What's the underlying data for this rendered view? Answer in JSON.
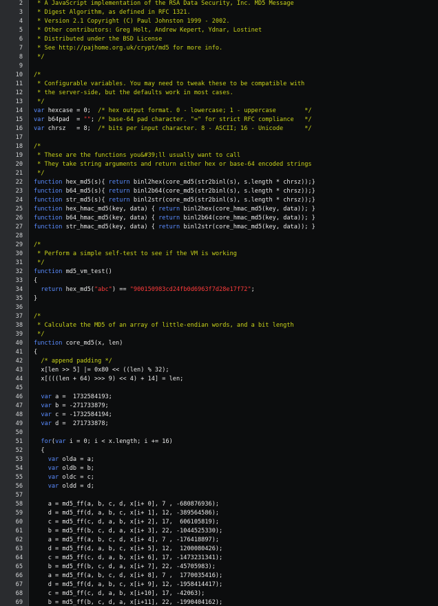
{
  "editor": {
    "language": "JavaScript",
    "colors": {
      "background": "#0c0d0e",
      "gutter": "#2a2c2f",
      "comment": "#c9d31a",
      "keyword": "#5a8cff",
      "string": "#ff3b3b",
      "text": "#eaeaea"
    },
    "lines": [
      {
        "n": "2",
        "t": " * A JavaScript implementation of the RSA Data Security, Inc. MD5 Message"
      },
      {
        "n": "3",
        "t": " * Digest Algorithm, as defined in RFC 1321."
      },
      {
        "n": "4",
        "t": " * Version 2.1 Copyright (C) Paul Johnston 1999 - 2002."
      },
      {
        "n": "5",
        "t": " * Other contributors: Greg Holt, Andrew Kepert, Ydnar, Lostinet"
      },
      {
        "n": "6",
        "t": " * Distributed under the BSD License"
      },
      {
        "n": "7",
        "t": " * See http://pajhome.org.uk/crypt/md5 for more info."
      },
      {
        "n": "8",
        "t": " */"
      },
      {
        "n": "9",
        "t": ""
      },
      {
        "n": "10",
        "t": "/*"
      },
      {
        "n": "11",
        "t": " * Configurable variables. You may need to tweak these to be compatible with"
      },
      {
        "n": "12",
        "t": " * the server-side, but the defaults work in most cases."
      },
      {
        "n": "13",
        "t": " */"
      },
      {
        "n": "14",
        "t": "var hexcase = 0;  /* hex output format. 0 - lowercase; 1 - uppercase        */"
      },
      {
        "n": "15",
        "t": "var b64pad  = \"\"; /* base-64 pad character. \"=\" for strict RFC compliance   */"
      },
      {
        "n": "16",
        "t": "var chrsz   = 8;  /* bits per input character. 8 - ASCII; 16 - Unicode      */"
      },
      {
        "n": "17",
        "t": ""
      },
      {
        "n": "18",
        "t": "/*"
      },
      {
        "n": "19",
        "t": " * These are the functions you&#39;ll usually want to call"
      },
      {
        "n": "20",
        "t": " * They take string arguments and return either hex or base-64 encoded strings"
      },
      {
        "n": "21",
        "t": " */"
      },
      {
        "n": "22",
        "t": "function hex_md5(s){ return binl2hex(core_md5(str2binl(s), s.length * chrsz));}"
      },
      {
        "n": "23",
        "t": "function b64_md5(s){ return binl2b64(core_md5(str2binl(s), s.length * chrsz));}"
      },
      {
        "n": "24",
        "t": "function str_md5(s){ return binl2str(core_md5(str2binl(s), s.length * chrsz));}"
      },
      {
        "n": "25",
        "t": "function hex_hmac_md5(key, data) { return binl2hex(core_hmac_md5(key, data)); }"
      },
      {
        "n": "26",
        "t": "function b64_hmac_md5(key, data) { return binl2b64(core_hmac_md5(key, data)); }"
      },
      {
        "n": "27",
        "t": "function str_hmac_md5(key, data) { return binl2str(core_hmac_md5(key, data)); }"
      },
      {
        "n": "28",
        "t": ""
      },
      {
        "n": "29",
        "t": "/*"
      },
      {
        "n": "30",
        "t": " * Perform a simple self-test to see if the VM is working"
      },
      {
        "n": "31",
        "t": " */"
      },
      {
        "n": "32",
        "t": "function md5_vm_test()"
      },
      {
        "n": "33",
        "t": "{"
      },
      {
        "n": "34",
        "t": "  return hex_md5(\"abc\") == \"900150983cd24fb0d6963f7d28e17f72\";"
      },
      {
        "n": "35",
        "t": "}"
      },
      {
        "n": "36",
        "t": ""
      },
      {
        "n": "37",
        "t": "/*"
      },
      {
        "n": "38",
        "t": " * Calculate the MD5 of an array of little-endian words, and a bit length"
      },
      {
        "n": "39",
        "t": " */"
      },
      {
        "n": "40",
        "t": "function core_md5(x, len)"
      },
      {
        "n": "41",
        "t": "{"
      },
      {
        "n": "42",
        "t": "  /* append padding */"
      },
      {
        "n": "43",
        "t": "  x[len >> 5] |= 0x80 << ((len) % 32);"
      },
      {
        "n": "44",
        "t": "  x[(((len + 64) >>> 9) << 4) + 14] = len;"
      },
      {
        "n": "45",
        "t": ""
      },
      {
        "n": "46",
        "t": "  var a =  1732584193;"
      },
      {
        "n": "47",
        "t": "  var b = -271733879;"
      },
      {
        "n": "48",
        "t": "  var c = -1732584194;"
      },
      {
        "n": "49",
        "t": "  var d =  271733878;"
      },
      {
        "n": "50",
        "t": ""
      },
      {
        "n": "51",
        "t": "  for(var i = 0; i < x.length; i += 16)"
      },
      {
        "n": "52",
        "t": "  {"
      },
      {
        "n": "53",
        "t": "    var olda = a;"
      },
      {
        "n": "54",
        "t": "    var oldb = b;"
      },
      {
        "n": "55",
        "t": "    var oldc = c;"
      },
      {
        "n": "56",
        "t": "    var oldd = d;"
      },
      {
        "n": "57",
        "t": ""
      },
      {
        "n": "58",
        "t": "    a = md5_ff(a, b, c, d, x[i+ 0], 7 , -680876936);"
      },
      {
        "n": "59",
        "t": "    d = md5_ff(d, a, b, c, x[i+ 1], 12, -389564586);"
      },
      {
        "n": "60",
        "t": "    c = md5_ff(c, d, a, b, x[i+ 2], 17,  606105819);"
      },
      {
        "n": "61",
        "t": "    b = md5_ff(b, c, d, a, x[i+ 3], 22, -1044525330);"
      },
      {
        "n": "62",
        "t": "    a = md5_ff(a, b, c, d, x[i+ 4], 7 , -176418897);"
      },
      {
        "n": "63",
        "t": "    d = md5_ff(d, a, b, c, x[i+ 5], 12,  1200080426);"
      },
      {
        "n": "64",
        "t": "    c = md5_ff(c, d, a, b, x[i+ 6], 17, -1473231341);"
      },
      {
        "n": "65",
        "t": "    b = md5_ff(b, c, d, a, x[i+ 7], 22, -45705983);"
      },
      {
        "n": "66",
        "t": "    a = md5_ff(a, b, c, d, x[i+ 8], 7 ,  1770035416);"
      },
      {
        "n": "67",
        "t": "    d = md5_ff(d, a, b, c, x[i+ 9], 12, -1958414417);"
      },
      {
        "n": "68",
        "t": "    c = md5_ff(c, d, a, b, x[i+10], 17, -42063);"
      },
      {
        "n": "69",
        "t": "    b = md5_ff(b, c, d, a, x[i+11], 22, -1990404162);"
      }
    ]
  }
}
